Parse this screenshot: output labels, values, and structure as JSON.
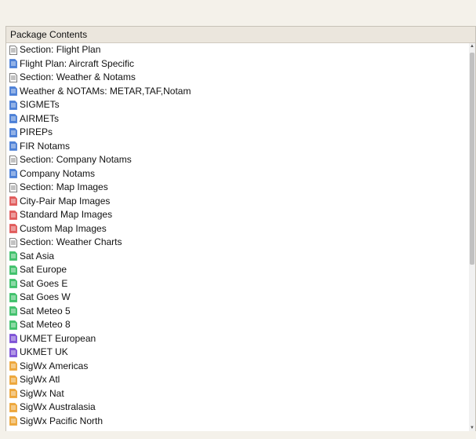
{
  "panel": {
    "header": "Package Contents",
    "items": [
      {
        "label": "Section: Flight Plan",
        "icon": "section-doc-icon",
        "color": "#a0a0a0"
      },
      {
        "label": "Flight Plan: Aircraft Specific",
        "icon": "blue-doc-icon",
        "color": "#4b7fd6"
      },
      {
        "label": "Section: Weather & Notams",
        "icon": "section-doc-icon",
        "color": "#a0a0a0"
      },
      {
        "label": "Weather & NOTAMs: METAR,TAF,Notam",
        "icon": "blue-doc-icon",
        "color": "#4b7fd6"
      },
      {
        "label": "SIGMETs",
        "icon": "blue-doc-icon",
        "color": "#4b7fd6"
      },
      {
        "label": "AIRMETs",
        "icon": "blue-doc-icon",
        "color": "#4b7fd6"
      },
      {
        "label": "PIREPs",
        "icon": "blue-doc-icon",
        "color": "#4b7fd6"
      },
      {
        "label": "FIR Notams",
        "icon": "blue-doc-icon",
        "color": "#4b7fd6"
      },
      {
        "label": "Section: Company Notams",
        "icon": "section-doc-icon",
        "color": "#a0a0a0"
      },
      {
        "label": "Company Notams",
        "icon": "blue-doc-icon",
        "color": "#4b7fd6"
      },
      {
        "label": "Section: Map Images",
        "icon": "section-doc-icon",
        "color": "#a0a0a0"
      },
      {
        "label": "City-Pair Map Images",
        "icon": "red-doc-icon",
        "color": "#e05a5a"
      },
      {
        "label": "Standard Map Images",
        "icon": "red-doc-icon",
        "color": "#e05a5a"
      },
      {
        "label": "Custom Map Images",
        "icon": "red-doc-icon",
        "color": "#e05a5a"
      },
      {
        "label": "Section: Weather Charts",
        "icon": "section-doc-icon",
        "color": "#a0a0a0"
      },
      {
        "label": "Sat Asia",
        "icon": "green-doc-icon",
        "color": "#3fc06a"
      },
      {
        "label": "Sat Europe",
        "icon": "green-doc-icon",
        "color": "#3fc06a"
      },
      {
        "label": "Sat Goes E",
        "icon": "green-doc-icon",
        "color": "#3fc06a"
      },
      {
        "label": "Sat Goes W",
        "icon": "green-doc-icon",
        "color": "#3fc06a"
      },
      {
        "label": "Sat Meteo 5",
        "icon": "green-doc-icon",
        "color": "#3fc06a"
      },
      {
        "label": "Sat Meteo 8",
        "icon": "green-doc-icon",
        "color": "#3fc06a"
      },
      {
        "label": "UKMET European",
        "icon": "purple-doc-icon",
        "color": "#7d52d6"
      },
      {
        "label": "UKMET UK",
        "icon": "purple-doc-icon",
        "color": "#7d52d6"
      },
      {
        "label": "SigWx Americas",
        "icon": "orange-doc-icon",
        "color": "#eda63a"
      },
      {
        "label": "SigWx Atl",
        "icon": "orange-doc-icon",
        "color": "#eda63a"
      },
      {
        "label": "SigWx Nat",
        "icon": "orange-doc-icon",
        "color": "#eda63a"
      },
      {
        "label": "SigWx Australasia",
        "icon": "orange-doc-icon",
        "color": "#eda63a"
      },
      {
        "label": "SigWx Pacific North",
        "icon": "orange-doc-icon",
        "color": "#eda63a"
      }
    ]
  }
}
